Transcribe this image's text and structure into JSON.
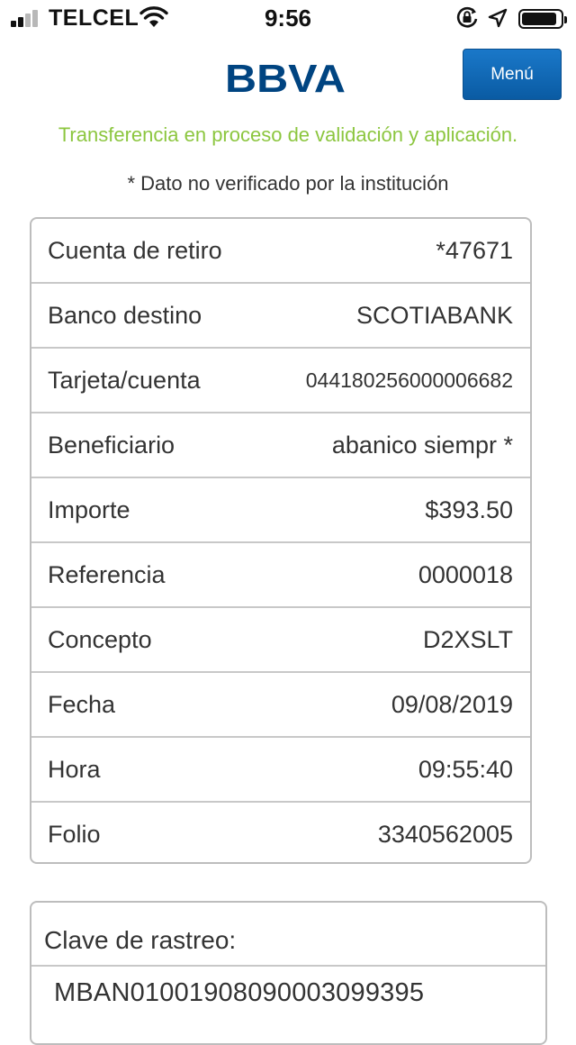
{
  "status_bar": {
    "carrier": "TELCEL",
    "time": "9:56",
    "signal_bars_filled": 2,
    "signal_bars_total": 4,
    "battery_level": 0.9
  },
  "header": {
    "logo_text": "BBVA",
    "menu_label": "Menú",
    "brand_color": "#004481",
    "button_color": "#1a78c9"
  },
  "status_message": "Transferencia en proceso de validación y aplicación.",
  "status_message_color": "#8cc63f",
  "note": "* Dato no verificado por la institución",
  "details": [
    {
      "label": "Cuenta de retiro",
      "value": "*47671"
    },
    {
      "label": "Banco destino",
      "value": "SCOTIABANK"
    },
    {
      "label": "Tarjeta/cuenta",
      "value": "044180256000006682"
    },
    {
      "label": "Beneficiario",
      "value": "abanico siempr *"
    },
    {
      "label": "Importe",
      "value": "$393.50"
    },
    {
      "label": "Referencia",
      "value": "0000018"
    },
    {
      "label": "Concepto",
      "value": "D2XSLT"
    },
    {
      "label": "Fecha",
      "value": "09/08/2019"
    },
    {
      "label": "Hora",
      "value": "09:55:40"
    },
    {
      "label": "Folio",
      "value": "3340562005"
    }
  ],
  "tracking": {
    "label": "Clave de rastreo:",
    "value": "MBAN01001908090003099395"
  },
  "icons": [
    "signal-icon",
    "wifi-icon",
    "orientation-lock-icon",
    "location-arrow-icon",
    "battery-icon"
  ]
}
